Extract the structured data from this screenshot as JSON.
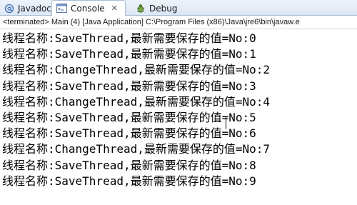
{
  "tabs": [
    {
      "label": "Javadoc",
      "icon": "at-icon"
    },
    {
      "label": "Console",
      "icon": "console-icon",
      "active": true
    },
    {
      "label": "Debug",
      "icon": "bug-icon"
    }
  ],
  "console": {
    "launch_info": "<terminated> Main (4) [Java Application] C:\\Program Files (x86)\\Java\\jre6\\bin\\javaw.e",
    "lines": [
      "线程名称:SaveThread,最新需要保存的值=No:0",
      "线程名称:SaveThread,最新需要保存的值=No:1",
      "线程名称:ChangeThread,最新需要保存的值=No:2",
      "线程名称:SaveThread,最新需要保存的值=No:3",
      "线程名称:ChangeThread,最新需要保存的值=No:4",
      "线程名称:SaveThread,最新需要保存的值=No:5",
      "线程名称:SaveThread,最新需要保存的值=No:6",
      "线程名称:ChangeThread,最新需要保存的值=No:7",
      "线程名称:SaveThread,最新需要保存的值=No:8",
      "线程名称:SaveThread,最新需要保存的值=No:9"
    ]
  },
  "colors": {
    "tab_gradient_top": "#eef3fa",
    "tab_gradient_bottom": "#dce7f5",
    "tab_border": "#a9bcd6",
    "text": "#000000"
  }
}
